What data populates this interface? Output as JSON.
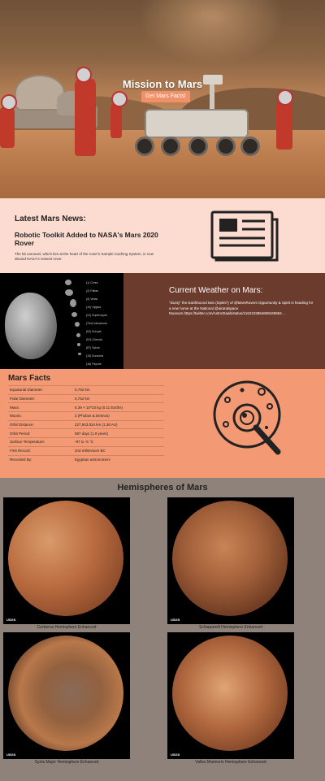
{
  "hero": {
    "title": "Mission to Mars",
    "button_label": "Get Mars Facts!"
  },
  "news": {
    "heading": "Latest Mars News:",
    "title": "Robotic Toolkit Added to NASA's Mars 2020 Rover",
    "teaser": "The bit carousel, which lies at the heart of the rover's Sample Caching System, is now aboard NASA's newest rover."
  },
  "weather": {
    "heading": "Current Weather on Mars:",
    "text": "\"Dusty\" the Earthbound twin (triplet?) of @MarsRovers Opportunity & Spirit is heading for a new home at the National @airandspace Museum.https://twitter.com/AstroStaab/status/1162103864608169984 ...",
    "image_labels": [
      "(1) Ceres",
      "(2) Pallas",
      "(4) Vesta",
      "(10) Hygiea",
      "(31) Euphrosyne",
      "(704) Interamnia",
      "(52) Europa",
      "(511) Davida",
      "(87) Sylvia",
      "(15) Eunomia",
      "(16) Psyche"
    ]
  },
  "facts": {
    "heading": "Mars Facts",
    "rows": [
      {
        "label": "Equatorial Diameter:",
        "value": "6,792 km"
      },
      {
        "label": "Polar Diameter:",
        "value": "6,752 km"
      },
      {
        "label": "Mass:",
        "value": "6.39 × 10^23 kg (0.11 Earths)"
      },
      {
        "label": "Moons:",
        "value": "2 (Phobos & Deimos)"
      },
      {
        "label": "Orbit Distance:",
        "value": "227,943,824 km (1.38 AU)"
      },
      {
        "label": "Orbit Period:",
        "value": "687 days (1.9 years)"
      },
      {
        "label": "Surface Temperature:",
        "value": "-87 to -5 °C"
      },
      {
        "label": "First Record:",
        "value": "2nd millennium BC"
      },
      {
        "label": "Recorded By:",
        "value": "Egyptian astronomers"
      }
    ]
  },
  "hemispheres": {
    "heading": "Hemispheres of Mars",
    "items": [
      {
        "title": "Cerberus Hemisphere Enhanced",
        "logo": "USGS",
        "color": "#b86a3e"
      },
      {
        "title": "Schiaparelli Hemisphere Enhanced",
        "logo": "USGS",
        "color": "#a2603a"
      },
      {
        "title": "Syrtis Major Hemisphere Enhanced",
        "logo": "USGS",
        "color": "#93613f"
      },
      {
        "title": "Valles Marineris Hemisphere Enhanced",
        "logo": "USGS",
        "color": "#b1683f"
      }
    ]
  },
  "colors": {
    "accent_button": "#f0916a",
    "news_bg": "#fcdcd0",
    "weather_bg": "#6b3b2d",
    "facts_bg": "#f39a74",
    "hemispheres_bg": "#8e827a"
  }
}
